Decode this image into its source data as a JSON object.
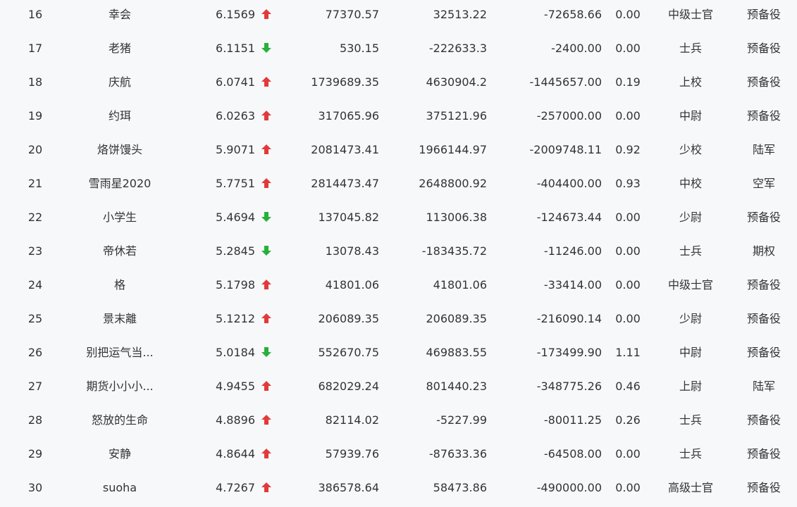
{
  "colors": {
    "up": "#e23a3a",
    "down": "#27b03a",
    "text": "#333333",
    "background": "#f7f8fa"
  },
  "rows": [
    {
      "rank": "16",
      "name": "幸会",
      "score": "6.1569",
      "trend": "up",
      "v1": "77370.57",
      "v2": "32513.22",
      "v3": "-72658.66",
      "v4": "0.00",
      "rank_name": "中级士官",
      "type": "预备役"
    },
    {
      "rank": "17",
      "name": "老猪",
      "score": "6.1151",
      "trend": "down",
      "v1": "530.15",
      "v2": "-222633.3",
      "v3": "-2400.00",
      "v4": "0.00",
      "rank_name": "士兵",
      "type": "预备役"
    },
    {
      "rank": "18",
      "name": "庆航",
      "score": "6.0741",
      "trend": "up",
      "v1": "1739689.35",
      "v2": "4630904.2",
      "v3": "-1445657.00",
      "v4": "0.19",
      "rank_name": "上校",
      "type": "预备役"
    },
    {
      "rank": "19",
      "name": "约珥",
      "score": "6.0263",
      "trend": "up",
      "v1": "317065.96",
      "v2": "375121.96",
      "v3": "-257000.00",
      "v4": "0.00",
      "rank_name": "中尉",
      "type": "预备役"
    },
    {
      "rank": "20",
      "name": "烙饼馒头",
      "score": "5.9071",
      "trend": "up",
      "v1": "2081473.41",
      "v2": "1966144.97",
      "v3": "-2009748.11",
      "v4": "0.92",
      "rank_name": "少校",
      "type": "陆军"
    },
    {
      "rank": "21",
      "name": "雪雨星2020",
      "score": "5.7751",
      "trend": "up",
      "v1": "2814473.47",
      "v2": "2648800.92",
      "v3": "-404400.00",
      "v4": "0.93",
      "rank_name": "中校",
      "type": "空军"
    },
    {
      "rank": "22",
      "name": "小学生",
      "score": "5.4694",
      "trend": "down",
      "v1": "137045.82",
      "v2": "113006.38",
      "v3": "-124673.44",
      "v4": "0.00",
      "rank_name": "少尉",
      "type": "预备役"
    },
    {
      "rank": "23",
      "name": "帝休若",
      "score": "5.2845",
      "trend": "down",
      "v1": "13078.43",
      "v2": "-183435.72",
      "v3": "-11246.00",
      "v4": "0.00",
      "rank_name": "士兵",
      "type": "期权"
    },
    {
      "rank": "24",
      "name": "格",
      "score": "5.1798",
      "trend": "up",
      "v1": "41801.06",
      "v2": "41801.06",
      "v3": "-33414.00",
      "v4": "0.00",
      "rank_name": "中级士官",
      "type": "预备役"
    },
    {
      "rank": "25",
      "name": "景末離",
      "score": "5.1212",
      "trend": "up",
      "v1": "206089.35",
      "v2": "206089.35",
      "v3": "-216090.14",
      "v4": "0.00",
      "rank_name": "少尉",
      "type": "预备役"
    },
    {
      "rank": "26",
      "name": "别把运气当...",
      "score": "5.0184",
      "trend": "down",
      "v1": "552670.75",
      "v2": "469883.55",
      "v3": "-173499.90",
      "v4": "1.11",
      "rank_name": "中尉",
      "type": "预备役"
    },
    {
      "rank": "27",
      "name": "期货小小小...",
      "score": "4.9455",
      "trend": "up",
      "v1": "682029.24",
      "v2": "801440.23",
      "v3": "-348775.26",
      "v4": "0.46",
      "rank_name": "上尉",
      "type": "陆军"
    },
    {
      "rank": "28",
      "name": "怒放的生命",
      "score": "4.8896",
      "trend": "up",
      "v1": "82114.02",
      "v2": "-5227.99",
      "v3": "-80011.25",
      "v4": "0.26",
      "rank_name": "士兵",
      "type": "预备役"
    },
    {
      "rank": "29",
      "name": "安静",
      "score": "4.8644",
      "trend": "up",
      "v1": "57939.76",
      "v2": "-87633.36",
      "v3": "-64508.00",
      "v4": "0.00",
      "rank_name": "士兵",
      "type": "预备役"
    },
    {
      "rank": "30",
      "name": "suoha",
      "score": "4.7267",
      "trend": "up",
      "v1": "386578.64",
      "v2": "58473.86",
      "v3": "-490000.00",
      "v4": "0.00",
      "rank_name": "高级士官",
      "type": "预备役"
    }
  ]
}
